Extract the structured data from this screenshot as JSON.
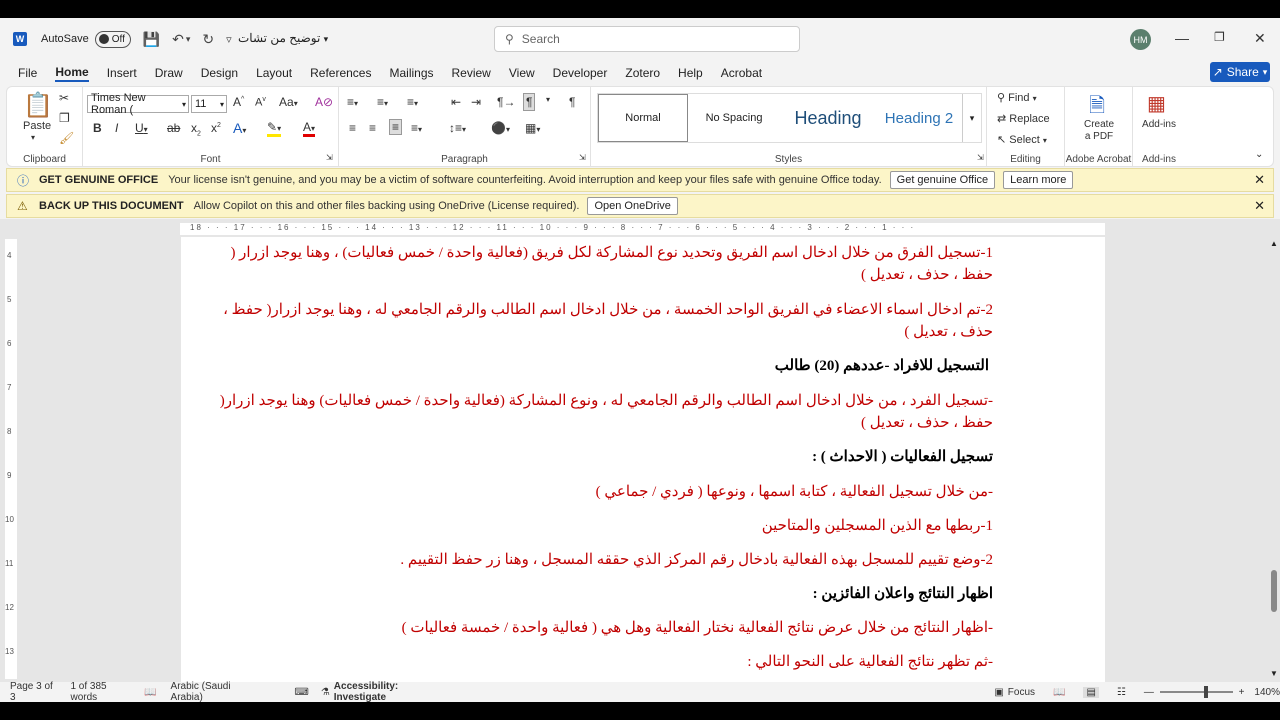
{
  "titlebar": {
    "autosave_label": "AutoSave",
    "autosave_state": "Off",
    "doc_title": "توضيح من تشات",
    "search_placeholder": "Search",
    "avatar_initials": "HM"
  },
  "menu": {
    "items": [
      "File",
      "Home",
      "Insert",
      "Draw",
      "Design",
      "Layout",
      "References",
      "Mailings",
      "Review",
      "View",
      "Developer",
      "Zotero",
      "Help",
      "Acrobat"
    ],
    "share_label": "Share"
  },
  "ribbon": {
    "clipboard": {
      "paste_label": "Paste",
      "group_label": "Clipboard"
    },
    "font": {
      "font_name": "Times New Roman (",
      "font_size": "11",
      "group_label": "Font"
    },
    "paragraph": {
      "group_label": "Paragraph"
    },
    "styles": {
      "items": [
        "Normal",
        "No Spacing",
        "Heading",
        "Heading 2"
      ],
      "group_label": "Styles"
    },
    "editing": {
      "find": "Find",
      "replace": "Replace",
      "select": "Select",
      "group_label": "Editing"
    },
    "acrobat": {
      "create_pdf_line1": "Create",
      "create_pdf_line2": "a PDF",
      "group_label": "Adobe Acrobat"
    },
    "addins": {
      "button_label": "Add-ins",
      "group_label": "Add-ins"
    }
  },
  "banners": [
    {
      "title": "GET GENUINE OFFICE",
      "message": "Your license isn't genuine, and you may be a victim of software counterfeiting. Avoid interruption and keep your files safe with genuine Office today.",
      "buttons": [
        "Get genuine Office",
        "Learn more"
      ]
    },
    {
      "title": "BACK UP THIS DOCUMENT",
      "message": "Allow Copilot on this and other files backing using OneDrive (License required).",
      "buttons": [
        "Open OneDrive"
      ]
    }
  ],
  "ruler_h_numbers": "18 · · · 17 · · · 16 · · · 15 · · · 14 · · · 13 · · · 12 · · · 11 · · · 10 · · · 9 · · · 8 · · · 7 · · · 6 · · · 5 · · · 4 · · · 3 · · · 2 · · · 1 · · ·",
  "ruler_v_numbers": [
    "4",
    "5",
    "6",
    "7",
    "8",
    "9",
    "10",
    "11",
    "12",
    "13"
  ],
  "document": {
    "lines": [
      {
        "text": "1-تسجيل الفرق من خلال ادخال اسم الفريق وتحديد نوع المشاركة لكل فريق (فعالية واحدة / خمس فعاليات) ، وهنا يوجد ازرار (",
        "style": "red"
      },
      {
        "text": "حفظ ، حذف ، تعديل )",
        "style": "red"
      },
      {
        "text": "2-تم ادخال اسماء الاعضاء في الفريق الواحد الخمسة ، من خلال ادخال اسم الطالب والرقم الجامعي له ، وهنا يوجد ازرار( حفظ ،",
        "style": "red"
      },
      {
        "text": "حذف ، تعديل )",
        "style": "red"
      },
      {
        "text": "التسجيل للافراد -عددهم (20) طالب",
        "style": "heading"
      },
      {
        "text": "-تسجيل الفرد ، من خلال ادخال اسم الطالب والرقم الجامعي له ، ونوع المشاركة (فعالية واحدة / خمس فعاليات) وهنا يوجد ازرار(",
        "style": "red"
      },
      {
        "text": "حفظ ، حذف ، تعديل )",
        "style": "red"
      },
      {
        "text": "تسجيل الفعاليات ( الاحداث ) :",
        "style": "heading"
      },
      {
        "text": "-من خلال تسجيل الفعالية ، كتابة اسمها ، ونوعها ( فردي / جماعي )",
        "style": "red"
      },
      {
        "text": "1-ربطها مع الذين المسجلين والمتاحين",
        "style": "red"
      },
      {
        "text": "2-وضع تقييم للمسجل بهذه الفعالية بادخال رقم المركز الذي حققه المسجل ، وهنا زر حفظ التقييم .",
        "style": "red"
      },
      {
        "text": "اظهار النتائج واعلان الفائزين :",
        "style": "heading"
      },
      {
        "text": "-اظهار النتائج من خلال عرض نتائج الفعالية نختار الفعالية وهل هي ( فعالية واحدة / خمسة فعاليات )",
        "style": "red"
      },
      {
        "text": "-ثم تظهر نتائج الفعالية على النحو التالي :",
        "style": "red"
      }
    ]
  },
  "status": {
    "page": "Page 3 of 3",
    "words": "1 of 385 words",
    "language": "Arabic (Saudi Arabia)",
    "accessibility": "Accessibility: Investigate",
    "focus": "Focus",
    "zoom": "140%"
  },
  "colors": {
    "accent": "#185abd",
    "doc_red": "#c00000",
    "banner_bg": "#fcf5c8"
  }
}
